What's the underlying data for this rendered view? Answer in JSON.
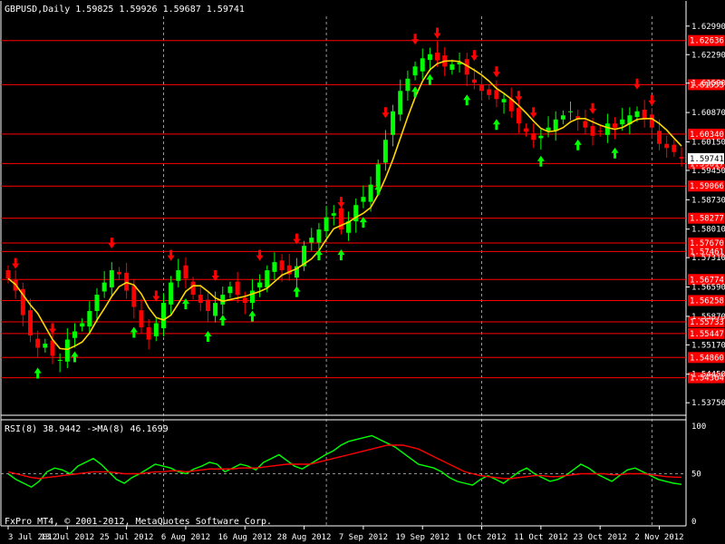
{
  "window": {
    "title": "GBPUSD,Daily  1.59825 1.59926 1.59687 1.59741",
    "indicator_label": "RSI(8) 38.9442  ->MA(8) 46.1699",
    "copyright": "FxPro MT4, © 2001-2012, MetaQuotes Software Corp."
  },
  "colors": {
    "background": "#000000",
    "bull": "#00ff00",
    "bear": "#ff0000",
    "ma": "#ffd700",
    "level_line": "#ff0000",
    "grid": "#c0c0c0",
    "axis_text": "#ffffff",
    "rsi": "#00ff00",
    "rsi_ma": "#ff0000",
    "level_tag_bg": "#ff0000"
  },
  "chart_data": [
    {
      "type": "candlestick",
      "symbol": "GBPUSD",
      "timeframe": "Daily",
      "ohlc_current": {
        "open": 1.59825,
        "high": 1.59926,
        "low": 1.59687,
        "close": 1.59741
      },
      "ylim": [
        1.5351,
        1.6323
      ],
      "y_ticks": [
        "1.62990",
        "1.62290",
        "1.61590",
        "1.60870",
        "1.60150",
        "1.59450",
        "1.58730",
        "1.58010",
        "1.57310",
        "1.56590",
        "1.55870",
        "1.55170",
        "1.54450",
        "1.53750"
      ],
      "x_ticks": [
        "3 Jul 2012",
        "13 Jul 2012",
        "25 Jul 2012",
        "6 Aug 2012",
        "16 Aug 2012",
        "28 Aug 2012",
        "7 Sep 2012",
        "19 Sep 2012",
        "1 Oct 2012",
        "11 Oct 2012",
        "23 Oct 2012",
        "2 Nov 2012"
      ],
      "x_tick_bar_index": [
        0,
        8,
        16,
        24,
        32,
        40,
        48,
        56,
        64,
        72,
        80,
        88
      ],
      "vgrid_bar_index": [
        21,
        43,
        64,
        87
      ],
      "current_price_tag": "1.59741",
      "horizontal_levels": [
        "1.62636",
        "1.61553",
        "1.60340",
        "1.59617",
        "1.59066",
        "1.58277",
        "1.57670",
        "1.57461",
        "1.56774",
        "1.56258",
        "1.55733",
        "1.55447",
        "1.54860",
        "1.54364"
      ],
      "close": [
        1.568,
        1.565,
        1.559,
        1.554,
        1.551,
        1.552,
        1.549,
        1.548,
        1.553,
        1.555,
        1.557,
        1.56,
        1.564,
        1.567,
        1.57,
        1.569,
        1.565,
        1.561,
        1.556,
        1.553,
        1.557,
        1.562,
        1.567,
        1.57,
        1.568,
        1.564,
        1.562,
        1.56,
        1.562,
        1.564,
        1.566,
        1.564,
        1.562,
        1.565,
        1.567,
        1.57,
        1.572,
        1.57,
        1.569,
        1.571,
        1.576,
        1.578,
        1.58,
        1.583,
        1.584,
        1.58,
        1.582,
        1.586,
        1.588,
        1.591,
        1.596,
        1.602,
        1.609,
        1.614,
        1.617,
        1.62,
        1.622,
        1.623,
        1.6215,
        1.62,
        1.6205,
        1.621,
        1.618,
        1.616,
        1.614,
        1.613,
        1.612,
        1.612,
        1.609,
        1.606,
        1.604,
        1.602,
        1.603,
        1.605,
        1.607,
        1.608,
        1.609,
        1.607,
        1.605,
        1.603,
        1.604,
        1.606,
        1.605,
        1.607,
        1.608,
        1.609,
        1.607,
        1.605,
        1.601,
        1.6,
        1.599,
        1.5974
      ],
      "ma_line": {
        "color": "#ffd700",
        "type": "moving_average"
      },
      "arrows_up_bar_index": [
        4,
        9,
        17,
        24,
        27,
        29,
        33,
        39,
        42,
        45,
        48,
        50,
        55,
        57,
        62,
        66,
        72,
        77,
        82
      ],
      "arrows_down_bar_index": [
        1,
        6,
        14,
        20,
        22,
        28,
        34,
        39,
        45,
        51,
        55,
        58,
        63,
        66,
        69,
        71,
        79,
        85,
        87
      ]
    },
    {
      "type": "line",
      "title": "RSI(8) 38.9442  ->MA(8) 46.1699",
      "ylim": [
        0,
        100
      ],
      "y_ticks": [
        "100",
        "50",
        "0"
      ],
      "dashed_level": 50,
      "series": [
        {
          "name": "RSI(8)",
          "color": "#00ff00",
          "values": [
            50,
            44,
            40,
            36,
            42,
            52,
            56,
            54,
            50,
            58,
            62,
            66,
            60,
            52,
            44,
            40,
            46,
            50,
            55,
            60,
            58,
            56,
            52,
            50,
            55,
            58,
            62,
            60,
            52,
            56,
            60,
            58,
            54,
            62,
            66,
            70,
            64,
            58,
            55,
            60,
            65,
            70,
            74,
            80,
            84,
            86,
            88,
            90,
            86,
            82,
            78,
            72,
            66,
            60,
            58,
            56,
            52,
            46,
            42,
            40,
            38,
            44,
            48,
            44,
            40,
            46,
            52,
            56,
            50,
            46,
            42,
            44,
            48,
            54,
            60,
            56,
            50,
            46,
            42,
            48,
            54,
            56,
            52,
            48,
            44,
            42,
            40,
            38.9
          ]
        },
        {
          "name": "MA(8)",
          "color": "#ff0000",
          "values": [
            52,
            50,
            48,
            46,
            45,
            46,
            47,
            48,
            49,
            50,
            51,
            52,
            52,
            52,
            51,
            50,
            50,
            50,
            51,
            52,
            52,
            53,
            53,
            52,
            53,
            54,
            55,
            55,
            55,
            55,
            56,
            56,
            56,
            57,
            58,
            59,
            60,
            60,
            60,
            60,
            62,
            64,
            66,
            68,
            70,
            72,
            74,
            76,
            78,
            80,
            80,
            80,
            78,
            76,
            72,
            68,
            64,
            60,
            56,
            52,
            50,
            48,
            47,
            46,
            45,
            45,
            46,
            47,
            48,
            48,
            47,
            47,
            48,
            49,
            50,
            50,
            50,
            50,
            49,
            49,
            50,
            50,
            50,
            49,
            48,
            47,
            46.5,
            46.2
          ]
        }
      ]
    }
  ]
}
